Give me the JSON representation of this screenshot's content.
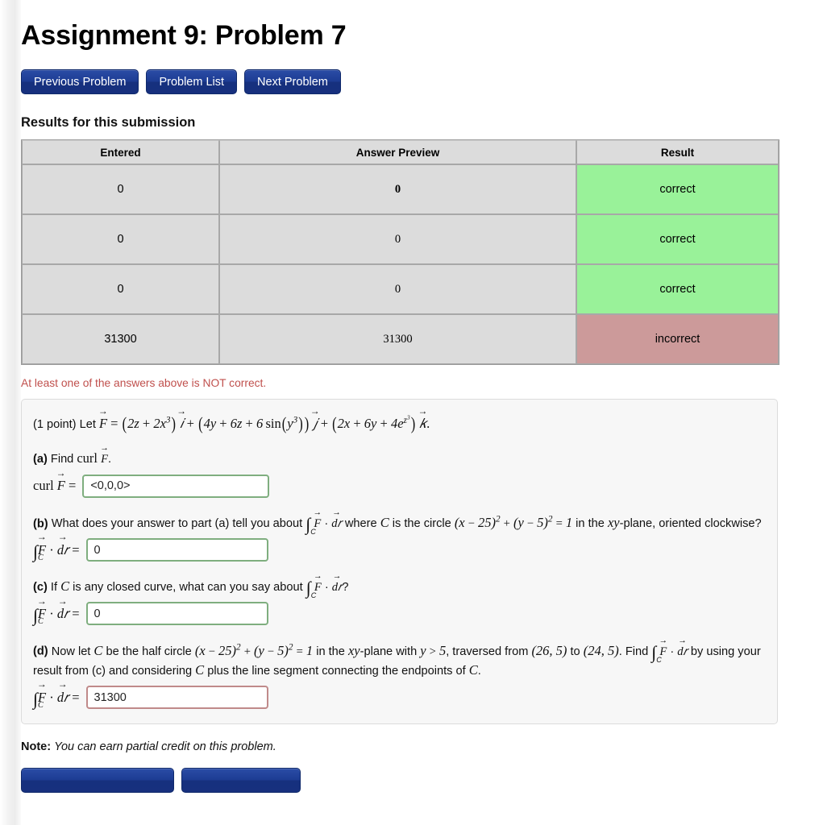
{
  "page": {
    "title": "Assignment 9: Problem 7"
  },
  "nav": {
    "previous_label": "Previous Problem",
    "list_label": "Problem List",
    "next_label": "Next Problem"
  },
  "results": {
    "heading": "Results for this submission",
    "columns": [
      "Entered",
      "Answer Preview",
      "Result"
    ],
    "rows": [
      {
        "entered": "0",
        "preview": "0",
        "result": "correct",
        "status": "correct"
      },
      {
        "entered": "0",
        "preview": "0",
        "result": "correct",
        "status": "correct"
      },
      {
        "entered": "0",
        "preview": "0",
        "result": "correct",
        "status": "correct"
      },
      {
        "entered": "31300",
        "preview": "31300",
        "result": "incorrect",
        "status": "incorrect"
      }
    ],
    "warning": "At least one of the answers above is NOT correct."
  },
  "problem": {
    "points_label": "(1 point) Let",
    "field_definition": "F = (2z + 2x^3) i + (4y + 6z + 6 sin(y^3)) j + (2x + 6y + 4e^{z^3}) k.",
    "parts": {
      "a": {
        "label": "(a)",
        "text": "Find curl F.",
        "prompt": "curl F =",
        "value": "<0,0,0>",
        "status": "correct"
      },
      "b": {
        "label": "(b)",
        "line1": "What does your answer to part (a) tell you about ∫_C F · dr where C is the circle (x − 25)² + (y − 5)² = 1 in the xy-plane,",
        "line2": "oriented clockwise?",
        "prompt": "∫_C F · dr =",
        "value": "0",
        "status": "correct"
      },
      "c": {
        "label": "(c)",
        "text": "If C is any closed curve, what can you say about ∫_C F · dr?",
        "prompt": "∫_C F · dr =",
        "value": "0",
        "status": "correct"
      },
      "d": {
        "label": "(d)",
        "line1": "Now let C be the half circle (x − 25)² + (y − 5)² = 1 in the xy-plane with y > 5, traversed from (26, 5) to (24, 5). Find",
        "line2": "∫_C F · dr by using your result from (c) and considering C plus the line segment connecting the endpoints of C.",
        "prompt": "∫_C F · dr =",
        "value": "31300",
        "status": "incorrect"
      }
    }
  },
  "note": {
    "prefix": "Note:",
    "text": "You can earn partial credit on this problem."
  },
  "footer_buttons": {
    "left_label": "",
    "right_label": ""
  },
  "colors": {
    "button_blue": "#1d3c93",
    "correct_green": "#99f299",
    "incorrect_red": "#cc9a9a",
    "warning_text": "#c0504d",
    "result_text": "#1f2f7a",
    "input_ok_border": "#7fae7f",
    "input_bad_border": "#c08a8a"
  }
}
